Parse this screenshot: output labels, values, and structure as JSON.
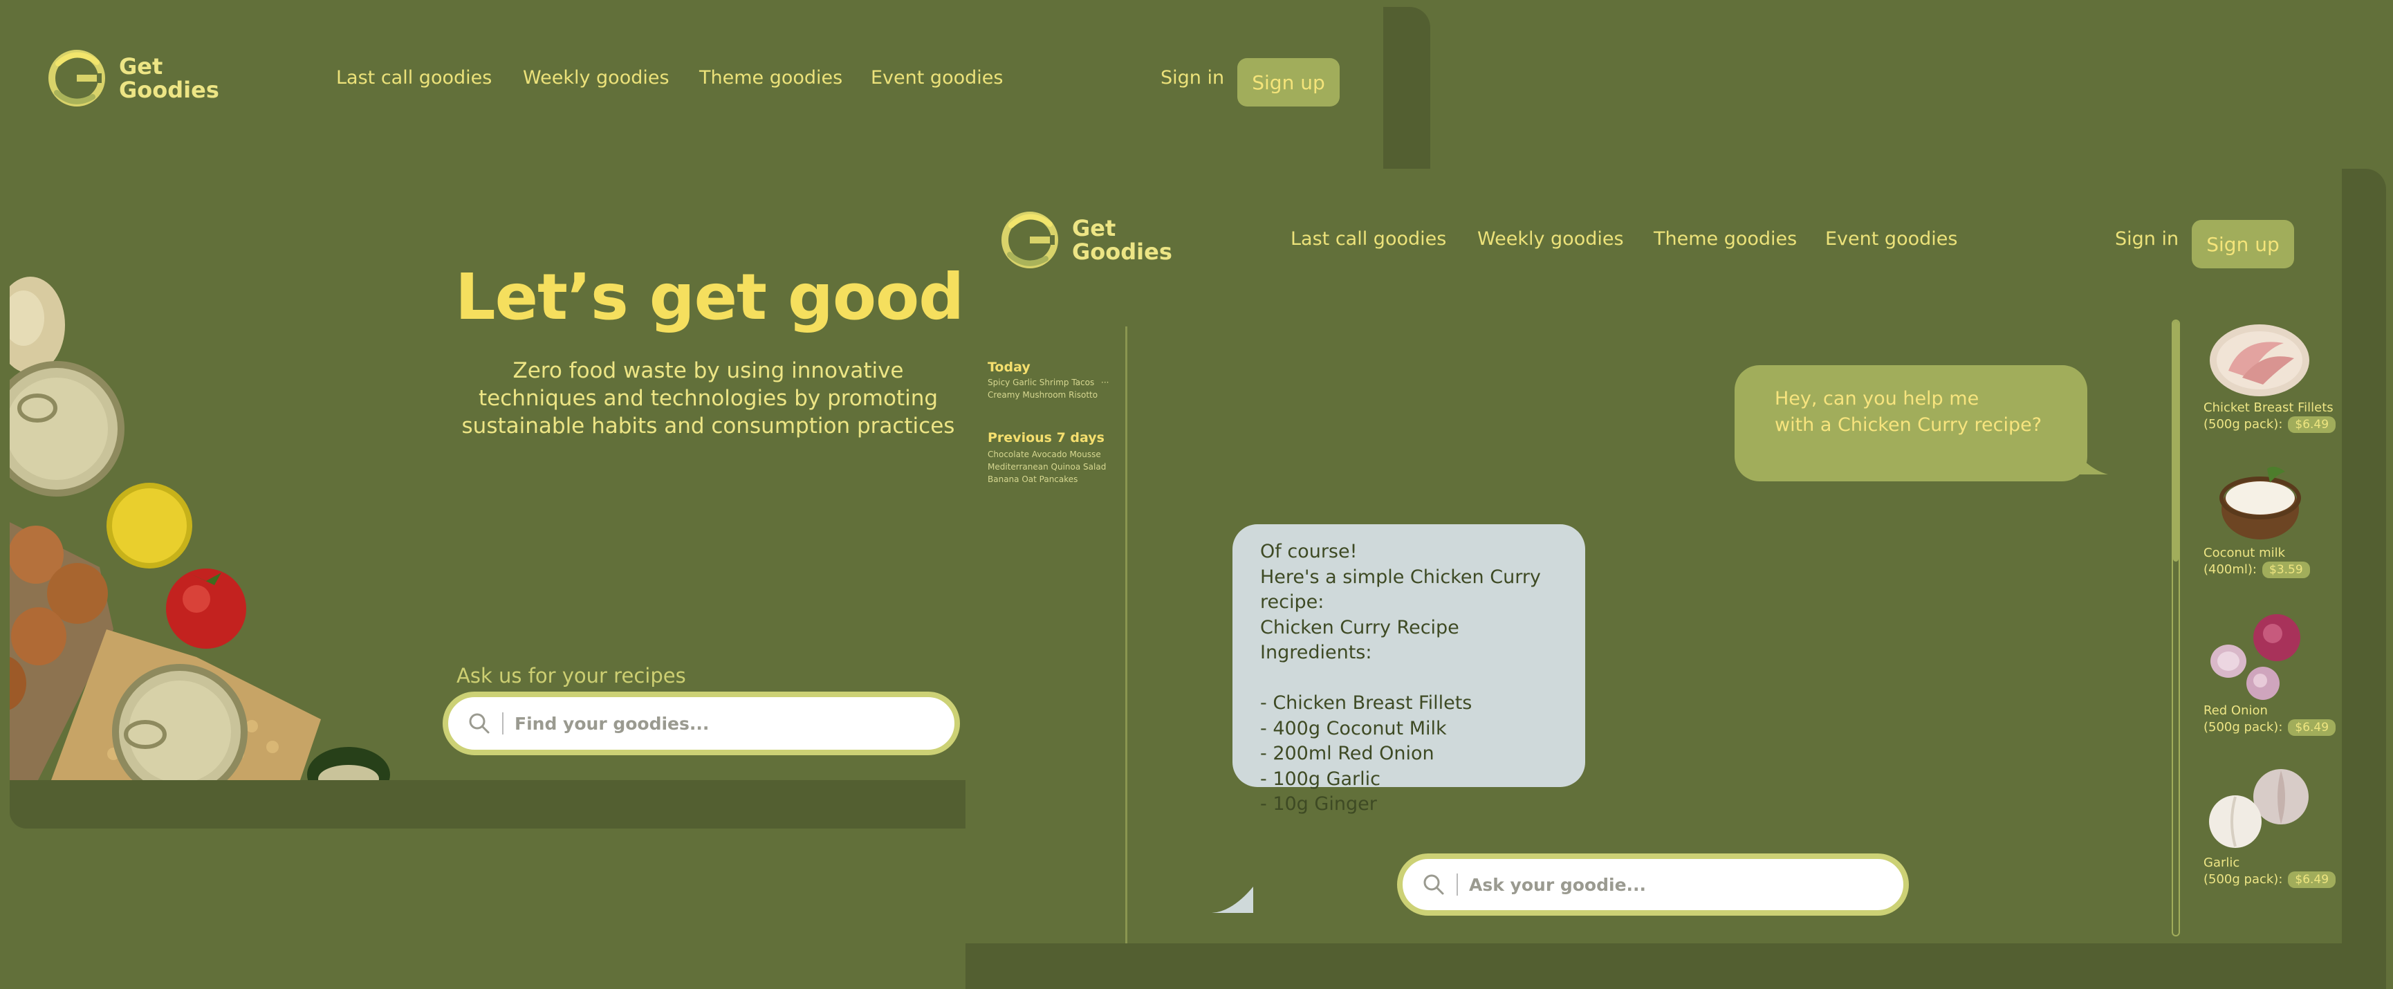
{
  "brand": {
    "line1": "Get",
    "line2": "Goodies"
  },
  "nav": [
    "Last call goodies",
    "Weekly goodies",
    "Theme goodies",
    "Event goodies"
  ],
  "auth": {
    "signin": "Sign in",
    "signup": "Sign up"
  },
  "landing": {
    "title": "Let’s get goodies",
    "subtitle": [
      "Zero food waste by using innovative",
      "techniques and technologies by promoting",
      "sustainable habits and consumption practices"
    ],
    "ask_label": "Ask us for your recipes",
    "search_placeholder": "Find your goodies..."
  },
  "chat": {
    "history": {
      "today_label": "Today",
      "today": [
        "Spicy Garlic Shrimp Tacos",
        "Creamy Mushroom Risotto"
      ],
      "today_more": "···",
      "prev_label": "Previous 7 days",
      "prev": [
        "Chocolate Avocado Mousse",
        "Mediterranean Quinoa Salad",
        "Banana Oat Pancakes"
      ]
    },
    "user_message": [
      "Hey, can you help me",
      "with a Chicken Curry recipe?"
    ],
    "bot_message": "Of course!\nHere's a simple Chicken Curry recipe:\nChicken Curry Recipe Ingredients:\n\n- Chicken Breast Fillets\n- 400g Coconut Milk\n- 200ml Red Onion\n- 100g Garlic\n- 10g Ginger",
    "input_placeholder": "Ask your goodie...",
    "products": [
      {
        "name": "Chicket Breast Fillets",
        "detail": "(500g pack):",
        "price": "$6.49"
      },
      {
        "name": "Coconut milk",
        "detail": "(400ml):",
        "price": "$3.59"
      },
      {
        "name": "Red Onion",
        "detail": "(500g pack):",
        "price": "$6.49"
      },
      {
        "name": "Garlic",
        "detail": "(500g pack):",
        "price": "$6.49"
      }
    ]
  },
  "colors": {
    "background": "#62703a",
    "frame": "#535f31",
    "accent": "#a1ad5b",
    "text": "#ece27a",
    "title": "#f5df5e",
    "bot_bubble": "#cfd9da"
  }
}
